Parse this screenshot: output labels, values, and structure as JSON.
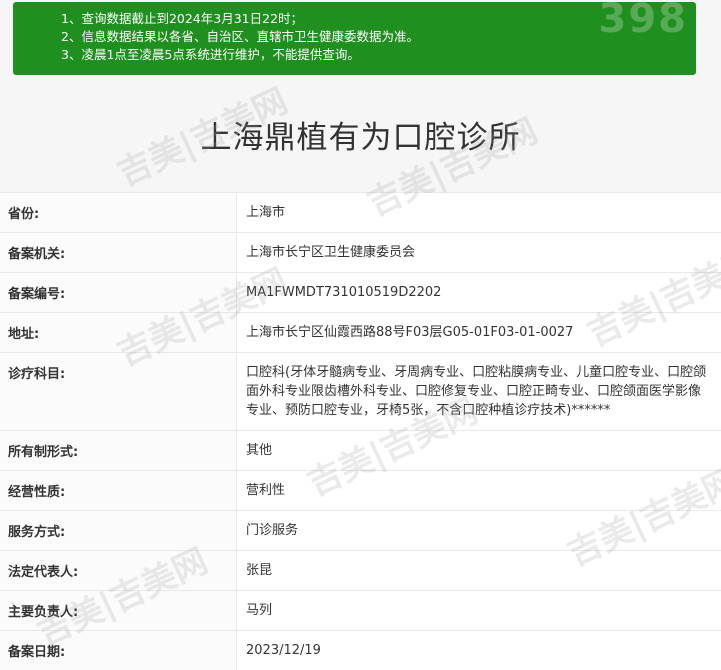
{
  "notice": {
    "lines": [
      "1、查询数据截止到2024年3月31日22时；",
      "2、信息数据结果以各省、自治区、直辖市卫生健康委数据为准。",
      "3、凌晨1点至凌晨5点系统进行维护，不能提供查询。"
    ],
    "logo": "398"
  },
  "title": "上海鼎植有为口腔诊所",
  "rows": [
    {
      "label": "省份:",
      "value": "上海市"
    },
    {
      "label": "备案机关:",
      "value": "上海市长宁区卫生健康委员会"
    },
    {
      "label": "备案编号:",
      "value": "MA1FWMDT731010519D2202"
    },
    {
      "label": "地址:",
      "value": "上海市长宁区仙霞西路88号F03层G05-01F03-01-0027"
    },
    {
      "label": "诊疗科目:",
      "value": "口腔科(牙体牙髓病专业、牙周病专业、口腔粘膜病专业、儿童口腔专业、口腔颌面外科专业限齿槽外科专业、口腔修复专业、口腔正畸专业、口腔颌面医学影像专业、预防口腔专业，牙椅5张，不含口腔种植诊疗技术)******"
    },
    {
      "label": "所有制形式:",
      "value": "其他"
    },
    {
      "label": "经营性质:",
      "value": "营利性"
    },
    {
      "label": "服务方式:",
      "value": "门诊服务"
    },
    {
      "label": "法定代表人:",
      "value": "张昆"
    },
    {
      "label": "主要负责人:",
      "value": "马列"
    },
    {
      "label": "备案日期:",
      "value": "2023/12/19"
    }
  ],
  "watermark": "吉美|吉美网"
}
